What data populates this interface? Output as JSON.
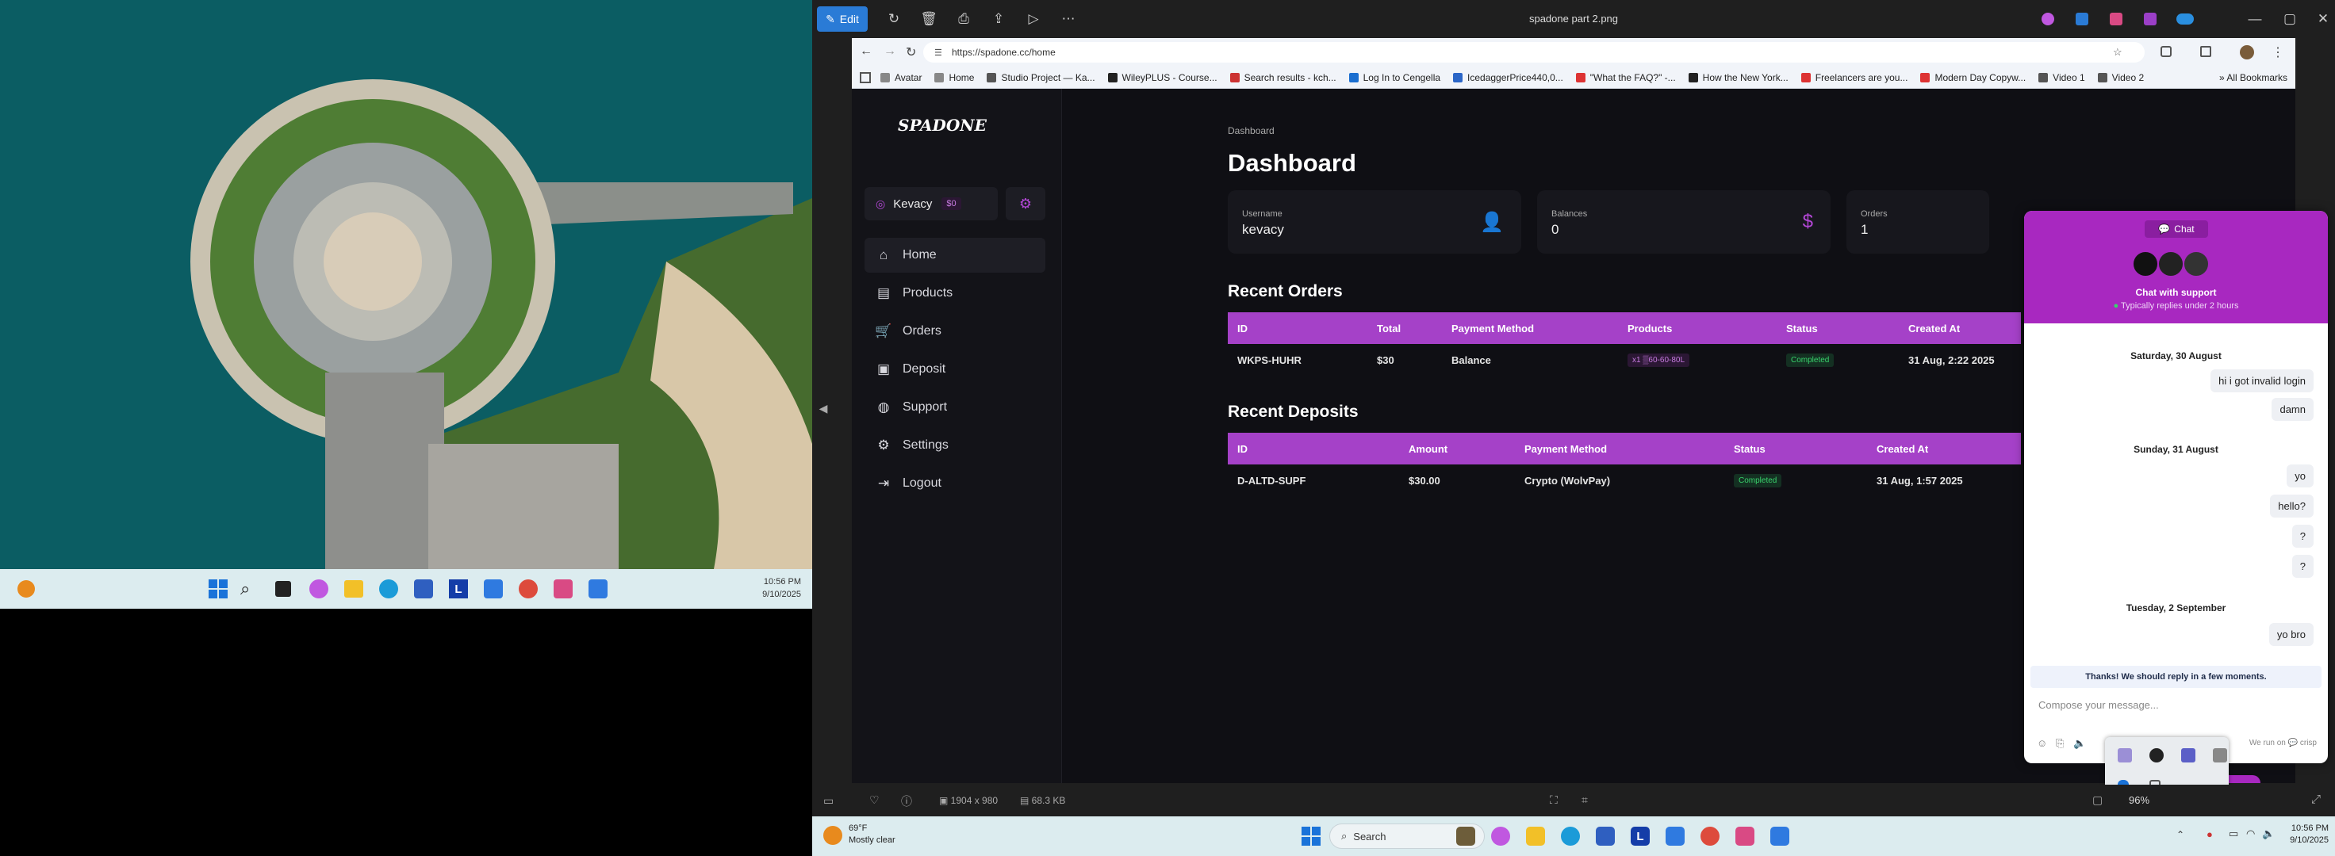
{
  "viewer": {
    "title": "spadone part 2.png",
    "edit_label": "Edit",
    "dimensions": "1904 x 980",
    "file_size": "68.3 KB",
    "zoom": "96%"
  },
  "browser": {
    "url": "https://spadone.cc/home",
    "bookmarks": [
      "Avatar",
      "Home",
      "Studio Project — Ka...",
      "WileyPLUS - Course...",
      "Search results - kch...",
      "Log In to Cengella",
      "IcedaggerPrice440,0...",
      "\"What the FAQ?\" -...",
      "How the New York...",
      "Freelancers are you...",
      "Modern Day Copyw...",
      "Video 1",
      "Video 2"
    ],
    "all_bookmarks": "All Bookmarks"
  },
  "site": {
    "logo": "SPADONE",
    "user": {
      "name": "Kevacy",
      "balance": "$0"
    },
    "nav": [
      "Home",
      "Products",
      "Orders",
      "Deposit",
      "Support",
      "Settings",
      "Logout"
    ],
    "breadcrumb": "Dashboard",
    "page_title": "Dashboard",
    "cards": [
      {
        "label": "Username",
        "value": "kevacy"
      },
      {
        "label": "Balances",
        "value": "0"
      },
      {
        "label": "Orders",
        "value": "1"
      }
    ],
    "orders": {
      "title": "Recent Orders",
      "headers": [
        "ID",
        "Total",
        "Payment Method",
        "Products",
        "Status",
        "Created At"
      ],
      "row": [
        "WKPS-HUHR",
        "$30",
        "Balance",
        "x1 ▒60-60-80L",
        "Completed",
        "31 Aug, 2:22 2025"
      ]
    },
    "deposits": {
      "title": "Recent Deposits",
      "headers": [
        "ID",
        "Amount",
        "Payment Method",
        "Status",
        "Created At"
      ],
      "row": [
        "D-ALTD-SUPF",
        "$30.00",
        "Crypto (WolvPay)",
        "Completed",
        "31 Aug, 1:57 2025"
      ]
    }
  },
  "chat": {
    "tab": "Chat",
    "title": "Chat with support",
    "subtitle": "Typically replies under 2 hours",
    "days": [
      "Saturday, 30 August",
      "Sunday, 31 August",
      "Tuesday, 2 September"
    ],
    "messages_sat": [
      "hi i got invalid login",
      "damn"
    ],
    "messages_sun": [
      "yo",
      "hello?",
      "?",
      "?"
    ],
    "messages_tue": [
      "yo bro"
    ],
    "notice": "Thanks! We should reply in a few moments.",
    "placeholder": "Compose your message...",
    "footer": "We run on",
    "footer_brand": "crisp"
  },
  "left_taskbar": {
    "time": "10:56 PM",
    "date": "9/10/2025"
  },
  "taskbar": {
    "weather_temp": "69°F",
    "weather_desc": "Mostly clear",
    "search": "Search",
    "time": "10:56 PM",
    "date": "9/10/2025"
  },
  "colors": {
    "accent": "#a541c8",
    "chat_head": "#a828c0",
    "status_green": "#39d36c"
  }
}
